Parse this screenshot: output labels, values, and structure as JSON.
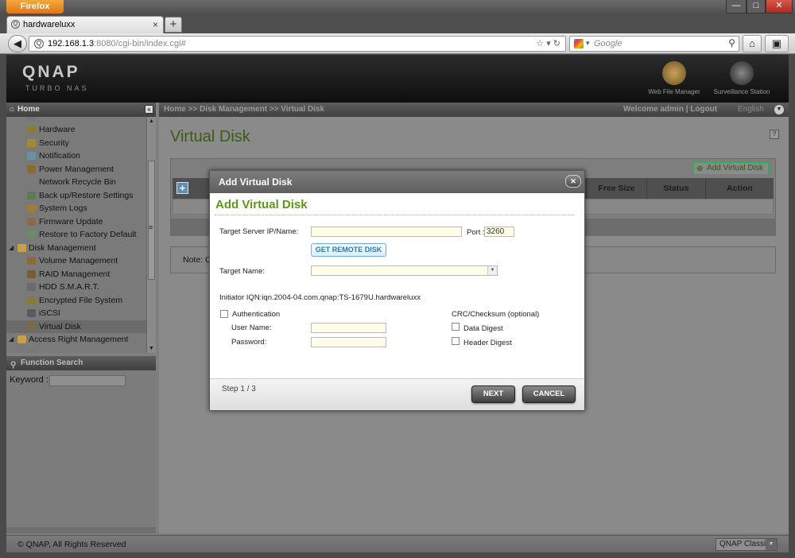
{
  "browser": {
    "menu_label": "Firefox",
    "tab_title": "hardwareluxx",
    "tab_close": "×",
    "new_tab": "+",
    "url_host": "192.168.1.3",
    "url_path": ":8080/cgi-bin/index.cgi#",
    "search_placeholder": "Google",
    "window_min": "—",
    "window_max": "□",
    "window_close": "✕"
  },
  "header": {
    "logo": "QNAP",
    "sublogo": "TURBO NAS",
    "apps": [
      {
        "label": "Web File Manager"
      },
      {
        "label": "Surveillance Station"
      }
    ]
  },
  "sidebar": {
    "title": "Home",
    "collapse": "«",
    "items": [
      {
        "label": "Hardware",
        "icon": "hardware-icon",
        "color": "#8a7a3a"
      },
      {
        "label": "Security",
        "icon": "security-icon",
        "color": "#a68b2e"
      },
      {
        "label": "Notification",
        "icon": "notification-icon",
        "color": "#6c8fa8"
      },
      {
        "label": "Power Management",
        "icon": "power-icon",
        "color": "#8c6a2c"
      },
      {
        "label": "Network Recycle Bin",
        "icon": "recycle-bin-icon",
        "color": "#7a7a7a"
      },
      {
        "label": "Back up/Restore Settings",
        "icon": "backup-icon",
        "color": "#5a7a5a"
      },
      {
        "label": "System Logs",
        "icon": "logs-icon",
        "color": "#a07a3a"
      },
      {
        "label": "Firmware Update",
        "icon": "firmware-icon",
        "color": "#8a6a4a"
      },
      {
        "label": "Restore to Factory Default",
        "icon": "restore-icon",
        "color": "#6a8a6a"
      },
      {
        "label": "Disk Management",
        "icon": "folder-icon",
        "color": "#c8a04a"
      },
      {
        "label": "Volume Management",
        "icon": "volume-icon",
        "color": "#8a6a3a"
      },
      {
        "label": "RAID Management",
        "icon": "raid-icon",
        "color": "#7a5a3a"
      },
      {
        "label": "HDD S.M.A.R.T.",
        "icon": "hdd-icon",
        "color": "#6a6a6a"
      },
      {
        "label": "Encrypted File System",
        "icon": "encrypt-icon",
        "color": "#8a7a3a"
      },
      {
        "label": "iSCSI",
        "icon": "iscsi-icon",
        "color": "#5a5a5a"
      },
      {
        "label": "Virtual Disk",
        "icon": "virtual-disk-icon",
        "color": "#7a6a4a"
      },
      {
        "label": "Access Right Management",
        "icon": "folder-icon",
        "color": "#c8a04a"
      }
    ],
    "function_search": "Function Search",
    "keyword_label": "Keyword :"
  },
  "topbar": {
    "breadcrumb": "Home >> Disk Management >> Virtual Disk",
    "welcome": "Welcome admin | Logout",
    "language": "English"
  },
  "main": {
    "title": "Virtual Disk",
    "add_button": "Add Virtual Disk",
    "columns": [
      "Free Size",
      "Status",
      "Action"
    ],
    "note": "Note: C"
  },
  "modal": {
    "header": "Add Virtual Disk",
    "title": "Add Virtual Disk",
    "close": "✕",
    "target_server_label": "Target Server IP/Name:",
    "port_label": "Port :",
    "port_value": "3260",
    "get_remote_disk": "GET REMOTE DISK",
    "target_name_label": "Target Name:",
    "initiator": "Initiator IQN:iqn.2004-04.com.qnap:TS-1679U.hardwareluxx",
    "authentication": "Authentication",
    "user_name_label": "User Name:",
    "password_label": "Password:",
    "crc_label": "CRC/Checksum (optional)",
    "data_digest": "Data Digest",
    "header_digest": "Header Digest",
    "step": "Step 1 / 3",
    "next": "NEXT",
    "cancel": "CANCEL"
  },
  "footer": {
    "copyright": "© QNAP, All Rights Reserved",
    "theme": "QNAP Classic"
  }
}
